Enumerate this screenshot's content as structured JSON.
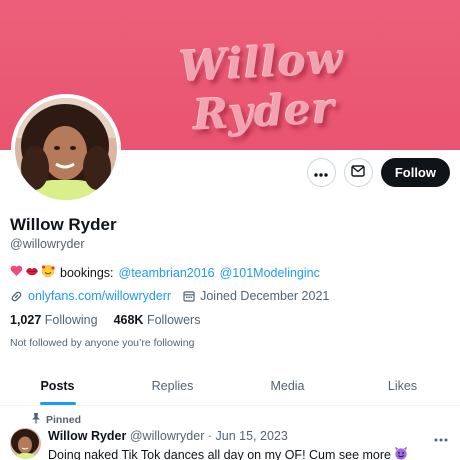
{
  "banner": {
    "text": "Willow Ryder",
    "color": "#ea5872"
  },
  "profile": {
    "name": "Willow Ryder",
    "handle": "@willowryder",
    "bio_icons": [
      "heart-icon",
      "lips-icon",
      "smiling-hearts-icon"
    ],
    "bio_prefix": "bookings:",
    "bio_mention_1": "@teambrian2016",
    "bio_mention_2": "@101Modelinginc",
    "website": "onlyfans.com/willowryderr",
    "joined": "Joined December 2021",
    "following_count": "1,027",
    "following_label": "Following",
    "followers_count": "468K",
    "followers_label": "Followers",
    "not_followed": "Not followed by anyone you’re following"
  },
  "actions": {
    "follow_label": "Follow"
  },
  "tabs": [
    {
      "label": "Posts",
      "active": true
    },
    {
      "label": "Replies",
      "active": false
    },
    {
      "label": "Media",
      "active": false
    },
    {
      "label": "Likes",
      "active": false
    }
  ],
  "tweet": {
    "pinned_label": "Pinned",
    "author": "Willow Ryder",
    "handle": "@willowryder",
    "separator": "·",
    "date": "Jun 15, 2023",
    "text": "Doing naked Tik Tok dances all day on my OF! Cum see more",
    "emoji_icon": "smiling-devil-icon"
  },
  "colors": {
    "accent": "#1d9bf0",
    "text": "#0f1419",
    "secondary": "#536471"
  }
}
